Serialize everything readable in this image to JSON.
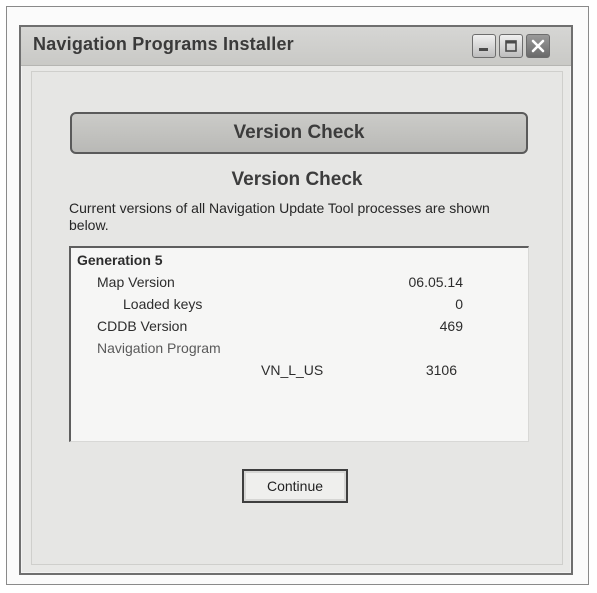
{
  "window": {
    "title": "Navigation Programs Installer",
    "controls": {
      "minimize_icon": "minimize-icon",
      "maximize_icon": "maximize-icon",
      "close_icon": "close-icon"
    }
  },
  "header": {
    "banner": "Version Check",
    "subheading": "Version Check",
    "description": "Current versions of all Navigation Update Tool processes are shown below."
  },
  "versions": {
    "group": "Generation 5",
    "map_version_label": "Map Version",
    "map_version_value": "06.05.14",
    "loaded_keys_label": "Loaded keys",
    "loaded_keys_value": "0",
    "cddb_version_label": "CDDB Version",
    "cddb_version_value": "469",
    "nav_program_label": "Navigation Program",
    "nav_program_name": "VN_L_US",
    "nav_program_value": "3106"
  },
  "actions": {
    "continue_label": "Continue"
  },
  "colors": {
    "window_bg": "#e8e8e6",
    "titlebar": "#cfcfcc",
    "banner": "#c2c2bf",
    "panel_bg": "#f6f6f5"
  }
}
